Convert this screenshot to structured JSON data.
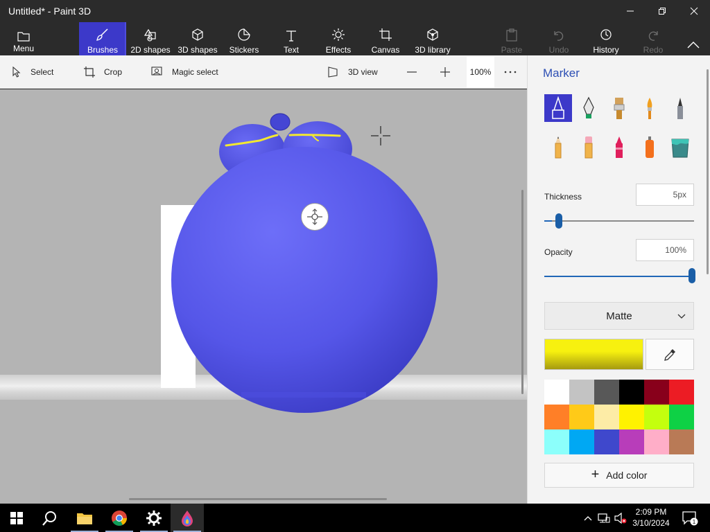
{
  "window": {
    "title": "Untitled* - Paint 3D"
  },
  "ribbon": {
    "menu": "Menu",
    "brushes": "Brushes",
    "shapes2d": "2D shapes",
    "shapes3d": "3D shapes",
    "stickers": "Stickers",
    "text": "Text",
    "effects": "Effects",
    "canvas": "Canvas",
    "library3d": "3D library",
    "paste": "Paste",
    "undo": "Undo",
    "history": "History",
    "redo": "Redo",
    "active_tab": "Brushes"
  },
  "commandbar": {
    "select": "Select",
    "crop": "Crop",
    "magic_select": "Magic select",
    "view3d": "3D view",
    "zoom": "100%"
  },
  "panel": {
    "title": "Marker",
    "brushes": [
      "marker",
      "calligraphy-pen",
      "oil-brush",
      "watercolor",
      "pixel-pen",
      "pencil",
      "eraser",
      "crayon",
      "spray-can",
      "fill"
    ],
    "selected_brush": "marker",
    "thickness_label": "Thickness",
    "thickness_value": "5px",
    "thickness_fraction": 0.05,
    "opacity_label": "Opacity",
    "opacity_value": "100%",
    "opacity_fraction": 1.0,
    "finish": "Matte",
    "current_color": "#f7f10f",
    "palette": [
      "#ffffff",
      "#c3c3c3",
      "#585858",
      "#000000",
      "#88001b",
      "#ec1c24",
      "#ff7f27",
      "#ffca18",
      "#fdeca6",
      "#fff200",
      "#c4ff0e",
      "#0ed145",
      "#8cfffb",
      "#00a8f3",
      "#3f48cc",
      "#b83dba",
      "#ffaec8",
      "#b97a56"
    ],
    "add_color": "Add color"
  },
  "canvas": {
    "model_color": "#5b5cf0",
    "stroke_color": "#f2e830"
  },
  "taskbar": {
    "time": "2:09 PM",
    "date": "3/10/2024",
    "notifications": "1"
  }
}
